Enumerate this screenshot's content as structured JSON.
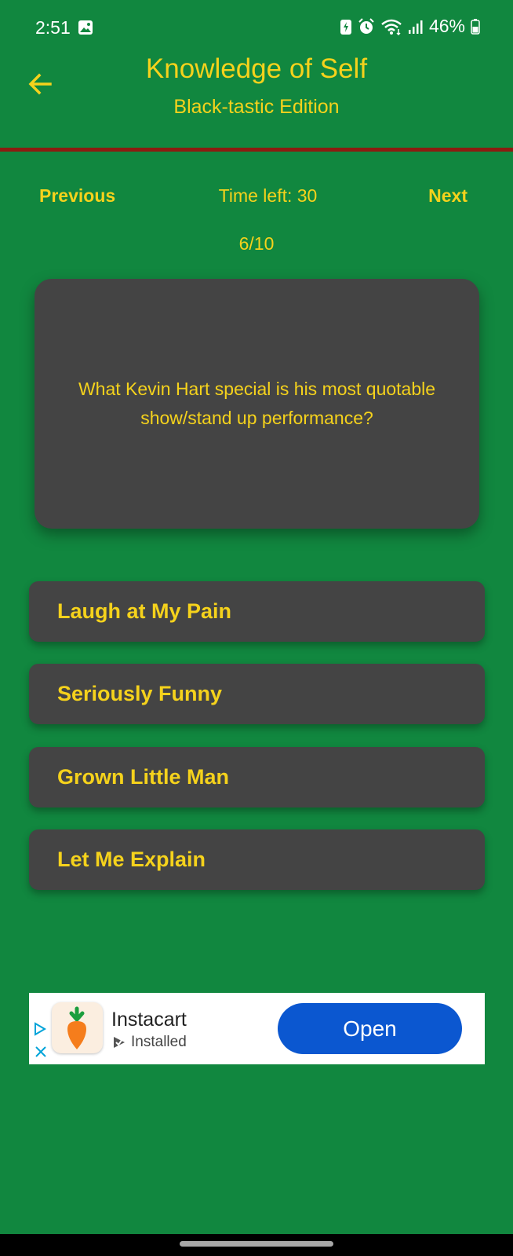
{
  "status_bar": {
    "time": "2:51",
    "battery_percent": "46%",
    "icons": [
      "gallery-icon",
      "battery-saver-icon",
      "alarm-icon",
      "wifi-icon",
      "signal-icon",
      "battery-icon"
    ]
  },
  "header": {
    "title": "Knowledge of Self",
    "subtitle": "Black-tastic Edition",
    "back_icon": "arrow-left-icon"
  },
  "quiz": {
    "previous_label": "Previous",
    "timer_text": "Time left: 30",
    "next_label": "Next",
    "progress_text": "6/10",
    "question": "What Kevin Hart special is his most quotable show/stand up performance?",
    "answers": [
      {
        "label": "Laugh at My Pain"
      },
      {
        "label": "Seriously Funny"
      },
      {
        "label": "Grown Little Man"
      },
      {
        "label": "Let Me Explain"
      }
    ]
  },
  "ad": {
    "app_name": "Instacart",
    "status": "Installed",
    "button_label": "Open"
  },
  "colors": {
    "background": "#11873f",
    "accent_text": "#f5d21c",
    "card": "#444444",
    "divider": "#8b1c10",
    "ad_button": "#0b57d0"
  }
}
